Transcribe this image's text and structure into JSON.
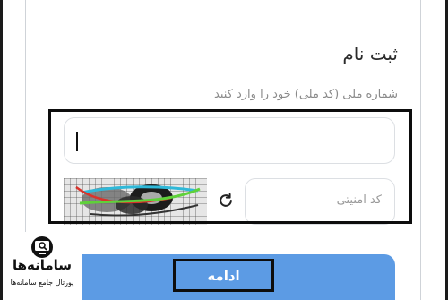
{
  "form": {
    "title": "ثبت نام",
    "subtitle": "شماره ملی (کد ملی) خود را وارد کنید",
    "national_id_value": "",
    "security_code_placeholder": "کد امنیتی",
    "continue_label": "ادامه"
  },
  "icons": {
    "refresh": "refresh-icon",
    "logo": "monitor-search-icon"
  },
  "watermark": {
    "name": "سامانه‌ها",
    "tagline": "پورتال جامع سامانه‌ها"
  },
  "colors": {
    "primary_button": "#5c9be4",
    "highlight_border": "#0d0d0d",
    "input_border": "#dcdfe3"
  }
}
